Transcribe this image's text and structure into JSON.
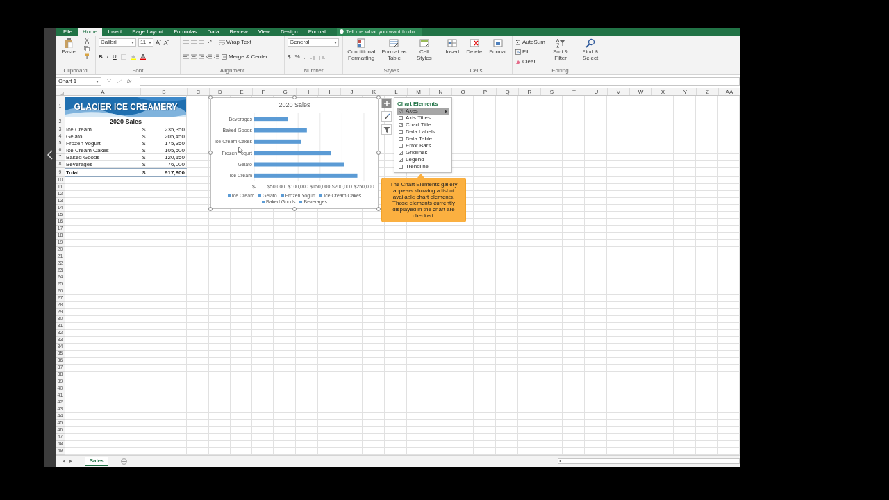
{
  "ribbon_tabs": [
    {
      "label": "File",
      "selected": false
    },
    {
      "label": "Home",
      "selected": true
    },
    {
      "label": "Insert",
      "selected": false
    },
    {
      "label": "Page Layout",
      "selected": false
    },
    {
      "label": "Formulas",
      "selected": false
    },
    {
      "label": "Data",
      "selected": false
    },
    {
      "label": "Review",
      "selected": false
    },
    {
      "label": "View",
      "selected": false
    },
    {
      "label": "Design",
      "selected": false
    },
    {
      "label": "Format",
      "selected": false
    }
  ],
  "tell_me": {
    "placeholder": "Tell me what you want to do..."
  },
  "ribbon": {
    "clipboard": {
      "paste": "Paste",
      "label": "Clipboard"
    },
    "font": {
      "font_name": "Calibri",
      "font_size": "11",
      "bold": "B",
      "italic": "I",
      "underline": "U",
      "label": "Font"
    },
    "alignment": {
      "wrap_text": "Wrap Text",
      "merge_center": "Merge & Center",
      "label": "Alignment"
    },
    "number": {
      "format": "General",
      "currency": "$",
      "percent": "%",
      "comma": ",",
      "label": "Number"
    },
    "styles": {
      "buttons": [
        "Conditional Formatting",
        "Format as Table",
        "Cell Styles"
      ],
      "label": "Styles"
    },
    "cells": {
      "buttons": [
        "Insert",
        "Delete",
        "Format"
      ],
      "label": "Cells"
    },
    "editing": {
      "autosum": "AutoSum",
      "fill": "Fill",
      "clear": "Clear",
      "buttons": [
        "Sort & Filter",
        "Find & Select"
      ],
      "label": "Editing"
    }
  },
  "formula_bar": {
    "name_box": "Chart 1",
    "function_label": "fx"
  },
  "columns": [
    "A",
    "B",
    "C",
    "D",
    "E",
    "F",
    "G",
    "H",
    "I",
    "J",
    "K",
    "L",
    "M",
    "N",
    "O",
    "P",
    "Q",
    "R",
    "S",
    "T",
    "U",
    "V",
    "W",
    "X",
    "Y",
    "Z",
    "AA"
  ],
  "row_numbers": [
    "1",
    "2",
    "3",
    "4",
    "5",
    "6",
    "7",
    "8",
    "9",
    "10",
    "11",
    "12",
    "13",
    "14",
    "15",
    "16",
    "17",
    "18",
    "19",
    "20",
    "21",
    "22",
    "23",
    "24",
    "25",
    "26",
    "27",
    "28",
    "29",
    "30",
    "31",
    "32",
    "33",
    "34",
    "35",
    "36",
    "37",
    "38",
    "39",
    "40",
    "41",
    "42",
    "43",
    "44",
    "45",
    "46",
    "47",
    "48",
    "49"
  ],
  "sheet": {
    "banner": "GLACIER ICE CREAMERY",
    "subtitle": "2020 Sales",
    "items": [
      {
        "name": "Ice Cream",
        "currency": "$",
        "amount": "235,350"
      },
      {
        "name": "Gelato",
        "currency": "$",
        "amount": "205,450"
      },
      {
        "name": "Frozen Yogurt",
        "currency": "$",
        "amount": "175,350"
      },
      {
        "name": "Ice Cream Cakes",
        "currency": "$",
        "amount": "105,500"
      },
      {
        "name": "Baked Goods",
        "currency": "$",
        "amount": "120,150"
      },
      {
        "name": "Beverages",
        "currency": "$",
        "amount": "76,000"
      }
    ],
    "total": {
      "name": "Total",
      "currency": "$",
      "amount": "917,800"
    }
  },
  "chart": {
    "chart_data": {
      "type": "bar",
      "orientation": "horizontal",
      "title": "2020 Sales",
      "categories": [
        "Beverages",
        "Baked Goods",
        "Ice Cream Cakes",
        "Frozen Yogurt",
        "Gelato",
        "Ice Cream"
      ],
      "grid": true,
      "series": [
        {
          "color": "#5b9bd5",
          "values": [
            76000,
            120000,
            106000,
            175000,
            205000,
            235000
          ]
        }
      ],
      "xlim": [
        0,
        250000
      ],
      "xticks": [
        {
          "value": 0,
          "label": "$-"
        },
        {
          "value": 50000,
          "label": "$50,000"
        },
        {
          "value": 100000,
          "label": "$100,000"
        },
        {
          "value": 150000,
          "label": "$150,000"
        },
        {
          "value": 200000,
          "label": "$200,000"
        },
        {
          "value": 250000,
          "label": "$250,000"
        }
      ]
    },
    "legend": [
      "Ice Cream",
      "Gelato",
      "Frozen Yogurt",
      "Ice Cream Cakes",
      "Baked Goods",
      "Beverages"
    ]
  },
  "chart_elements": {
    "title": "Chart Elements",
    "items": [
      {
        "label": "Axes",
        "checked": true,
        "selected": true
      },
      {
        "label": "Axis Titles",
        "checked": false,
        "selected": false
      },
      {
        "label": "Chart Title",
        "checked": true,
        "selected": false
      },
      {
        "label": "Data Labels",
        "checked": false,
        "selected": false
      },
      {
        "label": "Data Table",
        "checked": false,
        "selected": false
      },
      {
        "label": "Error Bars",
        "checked": false,
        "selected": false
      },
      {
        "label": "Gridlines",
        "checked": true,
        "selected": false
      },
      {
        "label": "Legend",
        "checked": true,
        "selected": false
      },
      {
        "label": "Trendline",
        "checked": false,
        "selected": false
      }
    ]
  },
  "callout": "The Chart Elements gallery appears showing a list of available chart elements. Those elements currently displayed in the chart are checked.",
  "sheet_tabs": [
    {
      "label": "...",
      "kind": "more"
    },
    {
      "label": "Sales",
      "kind": "sheet",
      "selected": true
    },
    {
      "label": "...",
      "kind": "more"
    }
  ]
}
